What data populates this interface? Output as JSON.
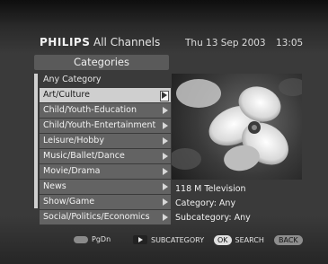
{
  "header": {
    "brand": "PHILIPS",
    "channel": "All Channels",
    "date": "Thu 13 Sep 2003",
    "time": "13:05"
  },
  "categories": {
    "title": "Categories",
    "items": [
      {
        "label": "Any Category"
      },
      {
        "label": "Art/Culture"
      },
      {
        "label": "Child/Youth-Education"
      },
      {
        "label": "Child/Youth-Entertainment"
      },
      {
        "label": "Leisure/Hobby"
      },
      {
        "label": "Music/Ballet/Dance"
      },
      {
        "label": "Movie/Drama"
      },
      {
        "label": "News"
      },
      {
        "label": "Show/Game"
      },
      {
        "label": "Social/Politics/Economics"
      }
    ],
    "selected": "Art/Culture"
  },
  "info": {
    "channel": "118 M Television",
    "category": "Category: Any",
    "subcategory": "Subcategory: Any"
  },
  "footer": {
    "pgdn": "PgDn",
    "subcategory": "SUBCATEGORY",
    "ok": "OK",
    "search": "SEARCH",
    "back": "BACK"
  },
  "icons": {
    "arrow": "right-triangle-icon",
    "pill": "remote-key-icon",
    "play": "play-icon"
  }
}
